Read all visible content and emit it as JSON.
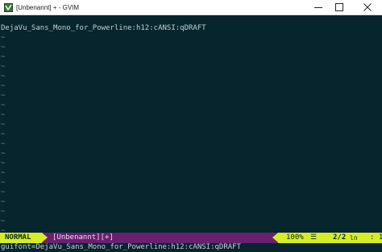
{
  "window": {
    "title": "[Unbenannt] + - GVIM"
  },
  "titlebar_buttons": {
    "minimize_icon": "minimize-icon",
    "maximize_icon": "maximize-icon",
    "close_icon": "close-icon"
  },
  "buffer": {
    "first_line": "DejaVu_Sans_Mono_for_Powerline:h12:cANSI:qDRAFT",
    "empty_line_marker": "~"
  },
  "statusline": {
    "mode": "NORMAL",
    "buffer_name": "[Unbenannt][+]",
    "percent": "100%",
    "lines_icon": "☰",
    "line": "2/2",
    "line_symbol": "ln",
    "column": ":  1"
  },
  "cmdline": {
    "text": "guifont=DejaVu_Sans_Mono_for_Powerline:h12:cANSI:qDRAFT"
  },
  "colors": {
    "editor_bg": "#06252d",
    "statusline_bg": "#6a1f6f",
    "accent": "#d6ed26"
  }
}
